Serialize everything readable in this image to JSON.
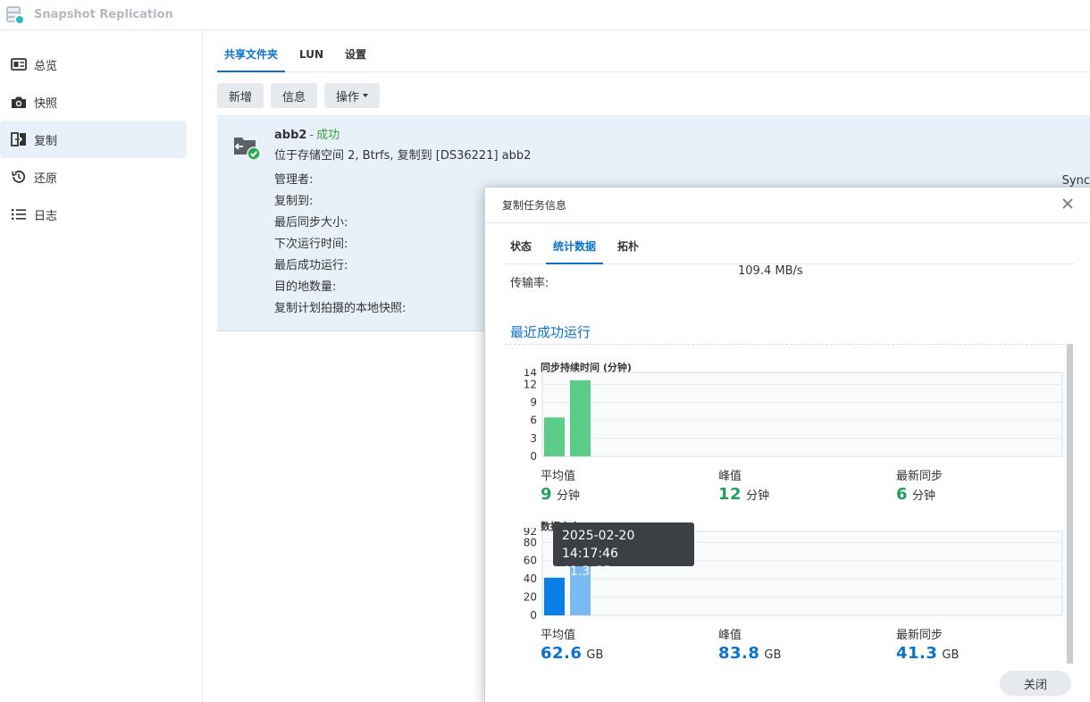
{
  "app": {
    "title": "Snapshot Replication"
  },
  "sidebar": {
    "items": [
      {
        "label": "总览",
        "icon": "overview-card-icon",
        "active": false
      },
      {
        "label": "快照",
        "icon": "camera-icon",
        "active": false
      },
      {
        "label": "复制",
        "icon": "replication-icon",
        "active": true
      },
      {
        "label": "还原",
        "icon": "restore-history-icon",
        "active": false
      },
      {
        "label": "日志",
        "icon": "log-list-icon",
        "active": false
      }
    ]
  },
  "tabs": [
    {
      "label": "共享文件夹",
      "active": true
    },
    {
      "label": "LUN",
      "active": false
    },
    {
      "label": "设置",
      "active": false
    }
  ],
  "toolbar": {
    "new": "新增",
    "info": "信息",
    "action": "操作"
  },
  "task": {
    "name": "abb2",
    "separator": "-",
    "status": "成功",
    "description": "位于存储空间 2, Btrfs, 复制到 [DS36221] abb2",
    "properties": [
      "管理者:",
      "复制到:",
      "最后同步大小:",
      "下次运行时间:",
      "最后成功运行:",
      "目的地数量:",
      "复制计划拍摄的本地快照:"
    ],
    "clipped_text": "Sync"
  },
  "dialog": {
    "title": "复制任务信息",
    "tabs": [
      {
        "label": "状态",
        "active": false
      },
      {
        "label": "统计数据",
        "active": true
      },
      {
        "label": "拓朴",
        "active": false
      }
    ],
    "rate_label": "传输率:",
    "rate_value": "109.4 MB/s",
    "section_title": "最近成功运行",
    "close_button": "关闭",
    "duration": {
      "title": "同步持续时间 (分钟)",
      "avg_label": "平均值",
      "avg_value": "9",
      "avg_unit": "分钟",
      "peak_label": "峰值",
      "peak_value": "12",
      "peak_unit": "分钟",
      "latest_label": "最新同步",
      "latest_value": "6",
      "latest_unit": "分钟"
    },
    "size": {
      "title": "数据大小 (GB)",
      "avg_label": "平均值",
      "avg_value": "62.6",
      "avg_unit": "GB",
      "peak_label": "峰值",
      "peak_value": "83.8",
      "peak_unit": "GB",
      "latest_label": "最新同步",
      "latest_value": "41.3",
      "latest_unit": "GB"
    },
    "tooltip": {
      "time": "2025-02-20 14:17:46",
      "value": "41.3 GB"
    }
  },
  "colors": {
    "accent": "#0a72cc",
    "success": "#3aa13a",
    "duration_bar": "#5ccd88",
    "size_bar_selected": "#0a7fe8",
    "size_bar": "#7ab9f2"
  },
  "chart_data": [
    {
      "type": "bar",
      "title": "同步持续时间 (分钟)",
      "x": [
        1,
        2
      ],
      "values": [
        6.5,
        12.7
      ],
      "yticks": [
        0,
        3,
        6,
        9,
        12,
        14
      ],
      "ylim": [
        0,
        14
      ],
      "grid": true
    },
    {
      "type": "bar",
      "title": "数据大小 (GB)",
      "x": [
        1,
        2
      ],
      "values": [
        41.3,
        83.8
      ],
      "yticks": [
        0,
        20,
        40,
        60,
        80,
        92
      ],
      "ylim": [
        0,
        92
      ],
      "grid": true
    }
  ]
}
